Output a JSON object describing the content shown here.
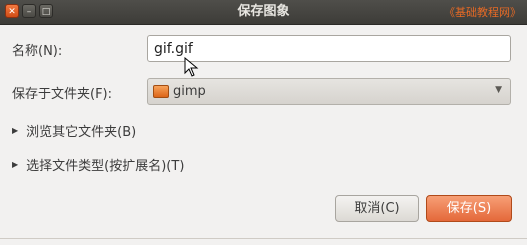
{
  "window": {
    "title": "保存图象",
    "watermark": "《基础教程网》",
    "buttons": [
      "close",
      "minimize",
      "maximize"
    ]
  },
  "form": {
    "name_label": "名称(N):",
    "name_value": "gif.gif",
    "folder_label": "保存于文件夹(F):",
    "folder_value": "gimp"
  },
  "expanders": {
    "browse_label": "浏览其它文件夹(B)",
    "filetype_label": "选择文件类型(按扩展名)(T)"
  },
  "actions": {
    "cancel_label": "取消(C)",
    "save_label": "保存(S)"
  },
  "colors": {
    "accent": "#e4683a",
    "titlebar": "#3d3c38",
    "background": "#f2f1f0"
  }
}
